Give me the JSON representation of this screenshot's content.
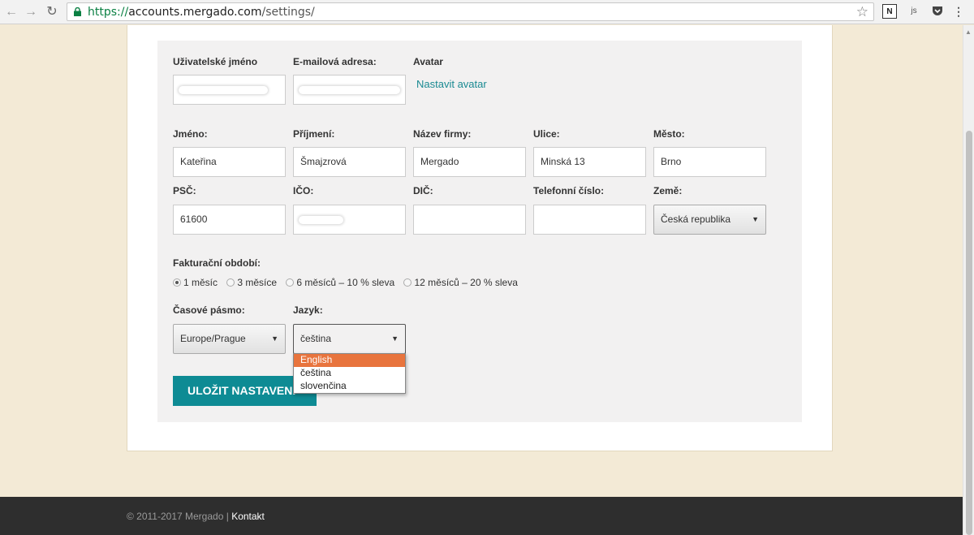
{
  "browser": {
    "url_scheme": "https://",
    "url_host": "accounts.mergado.com",
    "url_path": "/settings/",
    "ext_js_label": "js"
  },
  "account": {
    "username_label": "Uživatelské jméno",
    "email_label": "E-mailová adresa:",
    "avatar_label": "Avatar",
    "avatar_link": "Nastavit avatar"
  },
  "profile": {
    "first_name_label": "Jméno:",
    "first_name_value": "Kateřina",
    "last_name_label": "Příjmení:",
    "last_name_value": "Šmajzrová",
    "company_label": "Název firmy:",
    "company_value": "Mergado",
    "street_label": "Ulice:",
    "street_value": "Minská 13",
    "city_label": "Město:",
    "city_value": "Brno",
    "zip_label": "PSČ:",
    "zip_value": "61600",
    "ico_label": "IČO:",
    "dic_label": "DIČ:",
    "dic_value": "",
    "phone_label": "Telefonní číslo:",
    "phone_value": "",
    "country_label": "Země:",
    "country_value": "Česká republika"
  },
  "billing": {
    "label": "Fakturační období:",
    "options": [
      "1 měsíc",
      "3 měsíce",
      "6 měsíců – 10 % sleva",
      "12 měsíců – 20 % sleva"
    ],
    "selected_index": 0
  },
  "timezone": {
    "label": "Časové pásmo:",
    "value": "Europe/Prague"
  },
  "language": {
    "label": "Jazyk:",
    "value": "čeština",
    "options": [
      "English",
      "čeština",
      "slovenčina"
    ],
    "highlighted_index": 0
  },
  "save_button": "ULOŽIT NASTAVENÍ",
  "footer": {
    "copyright": "© 2011-2017 Mergado",
    "separator": "|",
    "contact": "Kontakt"
  },
  "colors": {
    "accent": "#0e8b94",
    "link": "#1a8a92",
    "dropdown_highlight": "#e8743d",
    "page_bg": "#f3ead6",
    "footer_bg": "#2e2e2e"
  }
}
